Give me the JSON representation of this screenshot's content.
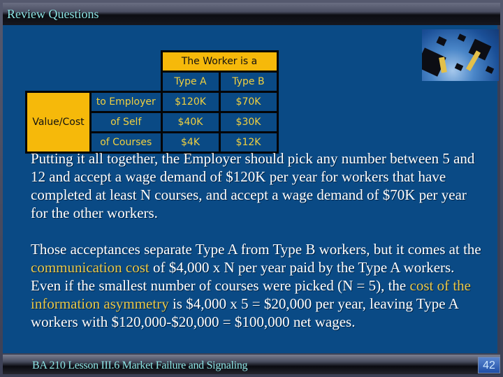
{
  "slide": {
    "title": "Review Questions",
    "footer": "BA 210  Lesson III.6 Market Failure and Signaling",
    "page_number": "42",
    "image": "graduation-caps-photo"
  },
  "table": {
    "header": "The Worker is a",
    "columns": [
      "Type A",
      "Type B"
    ],
    "row_group_label": "Value/Cost",
    "rows": [
      {
        "label": "to Employer",
        "values": [
          "$120K",
          "$70K"
        ]
      },
      {
        "label": "of Self",
        "values": [
          "$40K",
          "$30K"
        ]
      },
      {
        "label": "of Courses",
        "values": [
          "$4K",
          "$12K"
        ]
      }
    ]
  },
  "paragraph1": "Putting it all together, the Employer should pick any number between 5 and 12 and accept a wage demand of $120K per year for workers that have completed at least N courses, and accept a wage demand of $70K per year for the other workers.",
  "paragraph2": {
    "part1": "Those acceptances separate Type A from Type B workers, but it comes at the ",
    "highlight1": "communication cost",
    "part2": " of $4,000 x N per year paid by the Type A workers.  Even if the smallest number of courses were picked (N = 5), the ",
    "highlight2": "cost of the information asymmetry",
    "part3": " is $4,000 x 5 = $20,000 per year, leaving Type A workers with $120,000-$20,000 = $100,000 net wages."
  },
  "colors": {
    "background": "#0a4a85",
    "highlight": "#e8c84a",
    "header_fill": "#f6b90a",
    "title_text": "#8de4e4"
  }
}
